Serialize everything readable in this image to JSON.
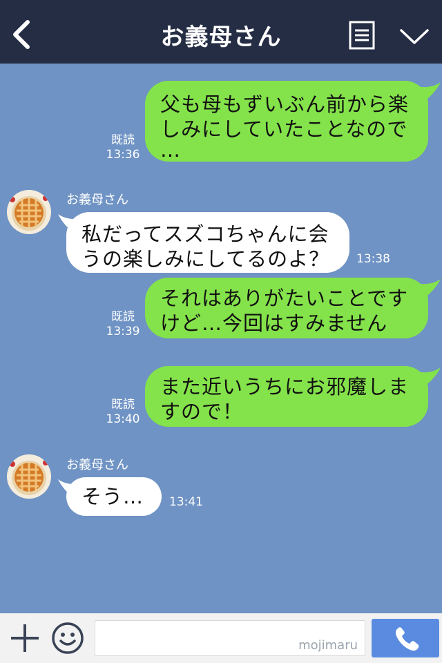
{
  "header": {
    "title": "お義母さん",
    "back_icon": "chevron-left-icon",
    "menu_icon": "menu-icon",
    "down_icon": "chevron-down-icon"
  },
  "messages": [
    {
      "dir": "out",
      "lines": [
        "父も母もずいぶん前から楽",
        "しみにしていたことなので",
        "…"
      ],
      "read": "既読",
      "time": "13:36"
    },
    {
      "dir": "in",
      "sender": "お義母さん",
      "lines": [
        "私だってスズコちゃんに会",
        "うの楽しみにしてるのよ？"
      ],
      "time": "13:38"
    },
    {
      "dir": "out",
      "lines": [
        "それはありがたいことです",
        "けど…今回はすみません"
      ],
      "read": "既読",
      "time": "13:39"
    },
    {
      "dir": "out",
      "lines": [
        "また近いうちにお邪魔しま",
        "すので！"
      ],
      "read": "既読",
      "time": "13:40"
    },
    {
      "dir": "in",
      "sender": "お義母さん",
      "lines": [
        "そう…"
      ],
      "time": "13:41"
    }
  ],
  "footer": {
    "plus_icon": "plus-icon",
    "emoji_icon": "smile-icon",
    "watermark": "mojimaru",
    "call_icon": "phone-icon"
  },
  "colors": {
    "header_bg": "#242d44",
    "chat_bg": "#6f93c4",
    "out_bubble": "#84e24b",
    "in_bubble": "#ffffff",
    "call_button": "#5a8be0"
  }
}
